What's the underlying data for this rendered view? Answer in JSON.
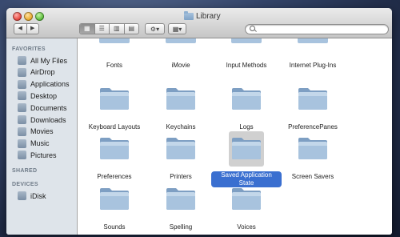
{
  "window": {
    "title": "Library",
    "search": {
      "placeholder": "",
      "value": ""
    }
  },
  "toolbar": {
    "back_icon": "chevron-left-icon",
    "forward_icon": "chevron-right-icon",
    "view_modes": [
      {
        "name": "icon-view",
        "icon": "grid-icon",
        "selected": true
      },
      {
        "name": "list-view",
        "icon": "list-icon",
        "selected": false
      },
      {
        "name": "column-view",
        "icon": "columns-icon",
        "selected": false
      },
      {
        "name": "cover-flow-view",
        "icon": "coverflow-icon",
        "selected": false
      }
    ],
    "action_icon": "gear-icon",
    "arrange_icon": "arrange-icon"
  },
  "sidebar": {
    "favorites_header": "FAVORITES",
    "favorites": [
      {
        "label": "All My Files",
        "icon": "all-files-icon"
      },
      {
        "label": "AirDrop",
        "icon": "airdrop-icon"
      },
      {
        "label": "Applications",
        "icon": "applications-icon"
      },
      {
        "label": "Desktop",
        "icon": "desktop-icon"
      },
      {
        "label": "Documents",
        "icon": "documents-icon"
      },
      {
        "label": "Downloads",
        "icon": "downloads-icon"
      },
      {
        "label": "Movies",
        "icon": "movies-icon"
      },
      {
        "label": "Music",
        "icon": "music-icon"
      },
      {
        "label": "Pictures",
        "icon": "pictures-icon"
      }
    ],
    "shared_header": "SHARED",
    "devices_header": "DEVICES",
    "devices": [
      {
        "label": "iDisk",
        "icon": "idisk-icon"
      }
    ]
  },
  "content": {
    "folders": [
      {
        "label": "Fonts"
      },
      {
        "label": "iMovie"
      },
      {
        "label": "Input Methods"
      },
      {
        "label": "Internet Plug-Ins"
      },
      {
        "label": "Keyboard Layouts"
      },
      {
        "label": "Keychains"
      },
      {
        "label": "Logs"
      },
      {
        "label": "PreferencePanes"
      },
      {
        "label": "Preferences"
      },
      {
        "label": "Printers"
      },
      {
        "label": "Saved Application State",
        "selected": true
      },
      {
        "label": "Screen Savers"
      },
      {
        "label": "Sounds"
      },
      {
        "label": "Spelling"
      },
      {
        "label": "Voices"
      }
    ]
  },
  "colors": {
    "selection": "#3a6fd0",
    "folder": "#8fb0d1",
    "sidebar_bg": "#dee4ea"
  }
}
